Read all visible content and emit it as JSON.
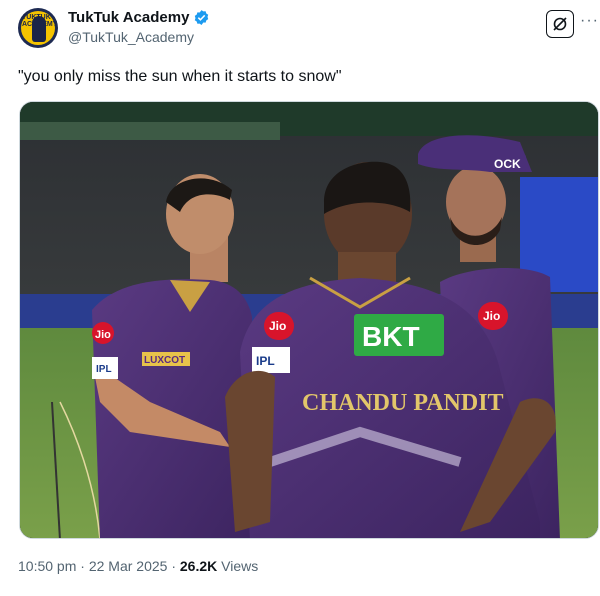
{
  "account": {
    "display_name": "TukTuk Academy",
    "handle": "@TukTuk_Academy",
    "avatar_text": "TUKTUK ACADEMY"
  },
  "tweet": {
    "text": "\"you only miss the sun when it starts to snow\""
  },
  "image": {
    "jersey_text_back": "CHANDU PANDIT",
    "sponsor_back": "BKT",
    "sponsor_sleeve": "Jio",
    "logo_cap": "OCK",
    "chest_text": "LUXCOT",
    "league_badge": "IPL"
  },
  "footer": {
    "time": "10:50 pm",
    "separator": "·",
    "date": "22 Mar 2025",
    "views_count": "26.2K",
    "views_label": "Views"
  },
  "colors": {
    "text_primary": "#0f1419",
    "text_secondary": "#536471",
    "verified": "#1d9bf0",
    "kkr_purple": "#4b2a6e",
    "kkr_gold": "#c9a043"
  }
}
